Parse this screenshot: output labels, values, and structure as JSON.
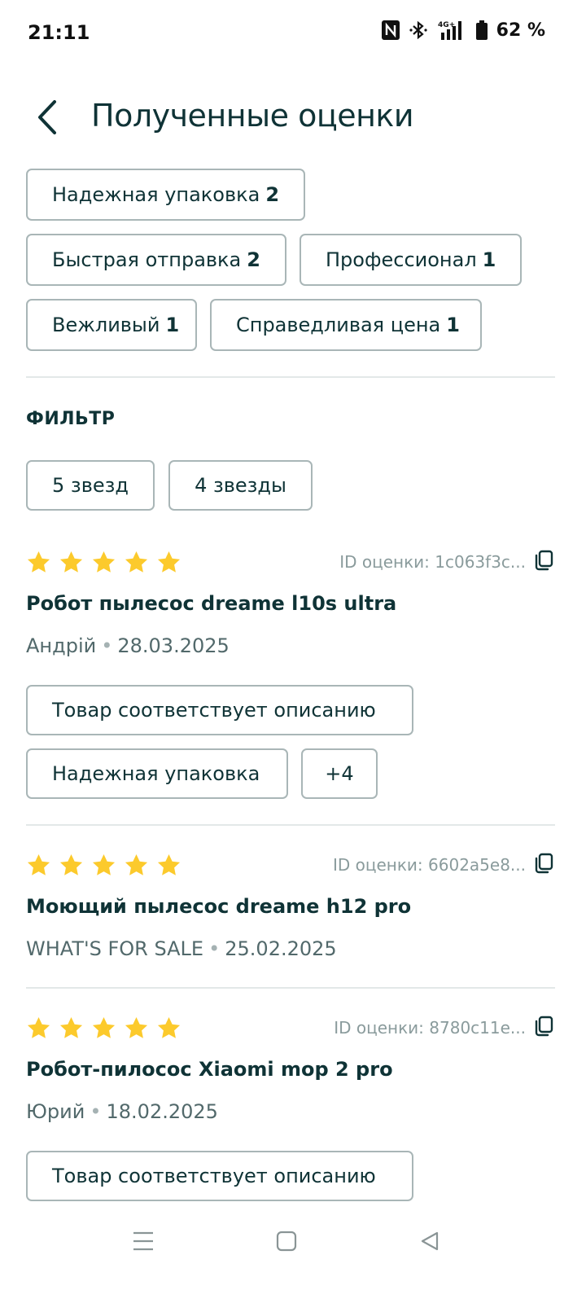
{
  "status_bar": {
    "time": "21:11",
    "network": "4G+",
    "battery": "62 %",
    "icons": [
      "nfc-icon",
      "bluetooth-icon",
      "signal-icon",
      "battery-icon"
    ]
  },
  "header": {
    "title": "Полученные оценки",
    "back_icon": "chevron-left-icon"
  },
  "rating_tags": [
    {
      "label": "Надежная упаковка",
      "count": "2"
    },
    {
      "label": "Быстрая отправка",
      "count": "2"
    },
    {
      "label": "Профессионал",
      "count": "1"
    },
    {
      "label": "Вежливый",
      "count": "1"
    },
    {
      "label": "Справедливая цена",
      "count": "1"
    }
  ],
  "filter": {
    "title": "ФИЛЬТР",
    "options": [
      "5 звезд",
      "4 звезды"
    ]
  },
  "reviews": [
    {
      "stars": 5,
      "id_label": "ID оценки: 1c063f3c...",
      "product": "Робот пылесос dreame l10s ultra",
      "author": "Андрій",
      "date": "28.03.2025",
      "tags": [
        "Товар соответствует описанию",
        "Надежная упаковка",
        "+4"
      ]
    },
    {
      "stars": 5,
      "id_label": "ID оценки: 6602a5e8...",
      "product": "Моющий пылесос dreame h12 pro",
      "author": "WHAT'S FOR SALE",
      "date": "25.02.2025",
      "tags": []
    },
    {
      "stars": 5,
      "id_label": "ID оценки: 8780c11e...",
      "product": "Робот-пилосос Xiaomi mop 2 pro",
      "author": "Юрий",
      "date": "18.02.2025",
      "tags": [
        "Товар соответствует описанию"
      ]
    }
  ],
  "colors": {
    "text": "#0f3336",
    "muted": "#52696b",
    "border": "#a9b6b7",
    "star": "#fcca2c",
    "divider": "#e3e8e8"
  },
  "nav_bar": {
    "icons": [
      "menu-icon",
      "home-square-icon",
      "back-triangle-icon"
    ]
  }
}
